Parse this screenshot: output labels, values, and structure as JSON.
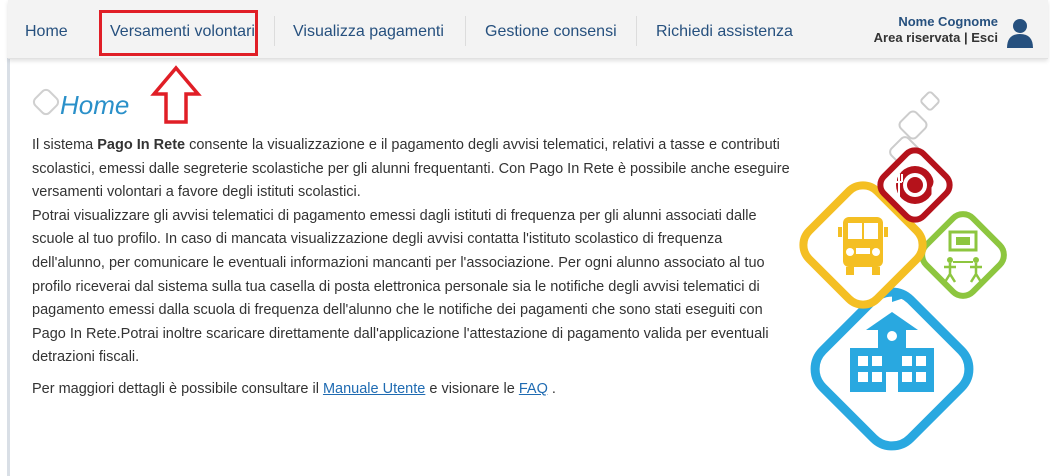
{
  "nav": {
    "items": [
      {
        "label": "Home"
      },
      {
        "label": "Versamenti volontari"
      },
      {
        "label": "Visualizza pagamenti"
      },
      {
        "label": "Gestione consensi"
      },
      {
        "label": "Richiedi assistenza"
      }
    ]
  },
  "user": {
    "name": "Nome Cognome",
    "reserved_area": "Area riservata",
    "separator": " | ",
    "exit": "Esci"
  },
  "page": {
    "title": "Home",
    "para1_pre": "Il sistema ",
    "para1_bold": "Pago In Rete",
    "para1_post": " consente la visualizzazione e il pagamento degli avvisi telematici, relativi a tasse e contributi scolastici, emessi dalle segreterie scolastiche per gli alunni frequentanti. Con Pago In Rete è possibile anche eseguire versamenti volontari a favore degli istituti scolastici.",
    "para2": "Potrai visualizzare gli avvisi telematici di pagamento emessi dagli istituti di frequenza per gli alunni associati dalle scuole al tuo profilo. In caso di mancata visualizzazione degli avvisi contatta l'istituto scolastico di frequenza dell'alunno, per comunicare le eventuali informazioni mancanti per l'associazione. Per ogni alunno associato al tuo profilo riceverai dal sistema sulla tua casella di posta elettronica personale sia le notifiche degli avvisi telematici di pagamento emessi dalla scuola di frequenza dell'alunno che le notifiche dei pagamenti che sono stati eseguiti con Pago In Rete.Potrai inoltre scaricare direttamente dall'applicazione l'attestazione di pagamento valida per eventuali detrazioni fiscali.",
    "para3_pre": "Per maggiori dettagli è possibile consultare il ",
    "manual_link": "Manuale Utente",
    "para3_mid": " e visionare le ",
    "faq_link": "FAQ",
    "para3_post": " ."
  },
  "colors": {
    "highlight": "#e01e26",
    "nav_text": "#26507e",
    "title": "#2a90c9",
    "link": "#1f6bb2",
    "red": "#b5121b",
    "yellow": "#f4bf23",
    "green": "#8dc63f",
    "blue": "#29a8e0"
  },
  "icons": [
    "user-icon",
    "up-arrow-icon",
    "dining-icon",
    "school-bus-icon",
    "museum-icon",
    "school-building-icon"
  ]
}
